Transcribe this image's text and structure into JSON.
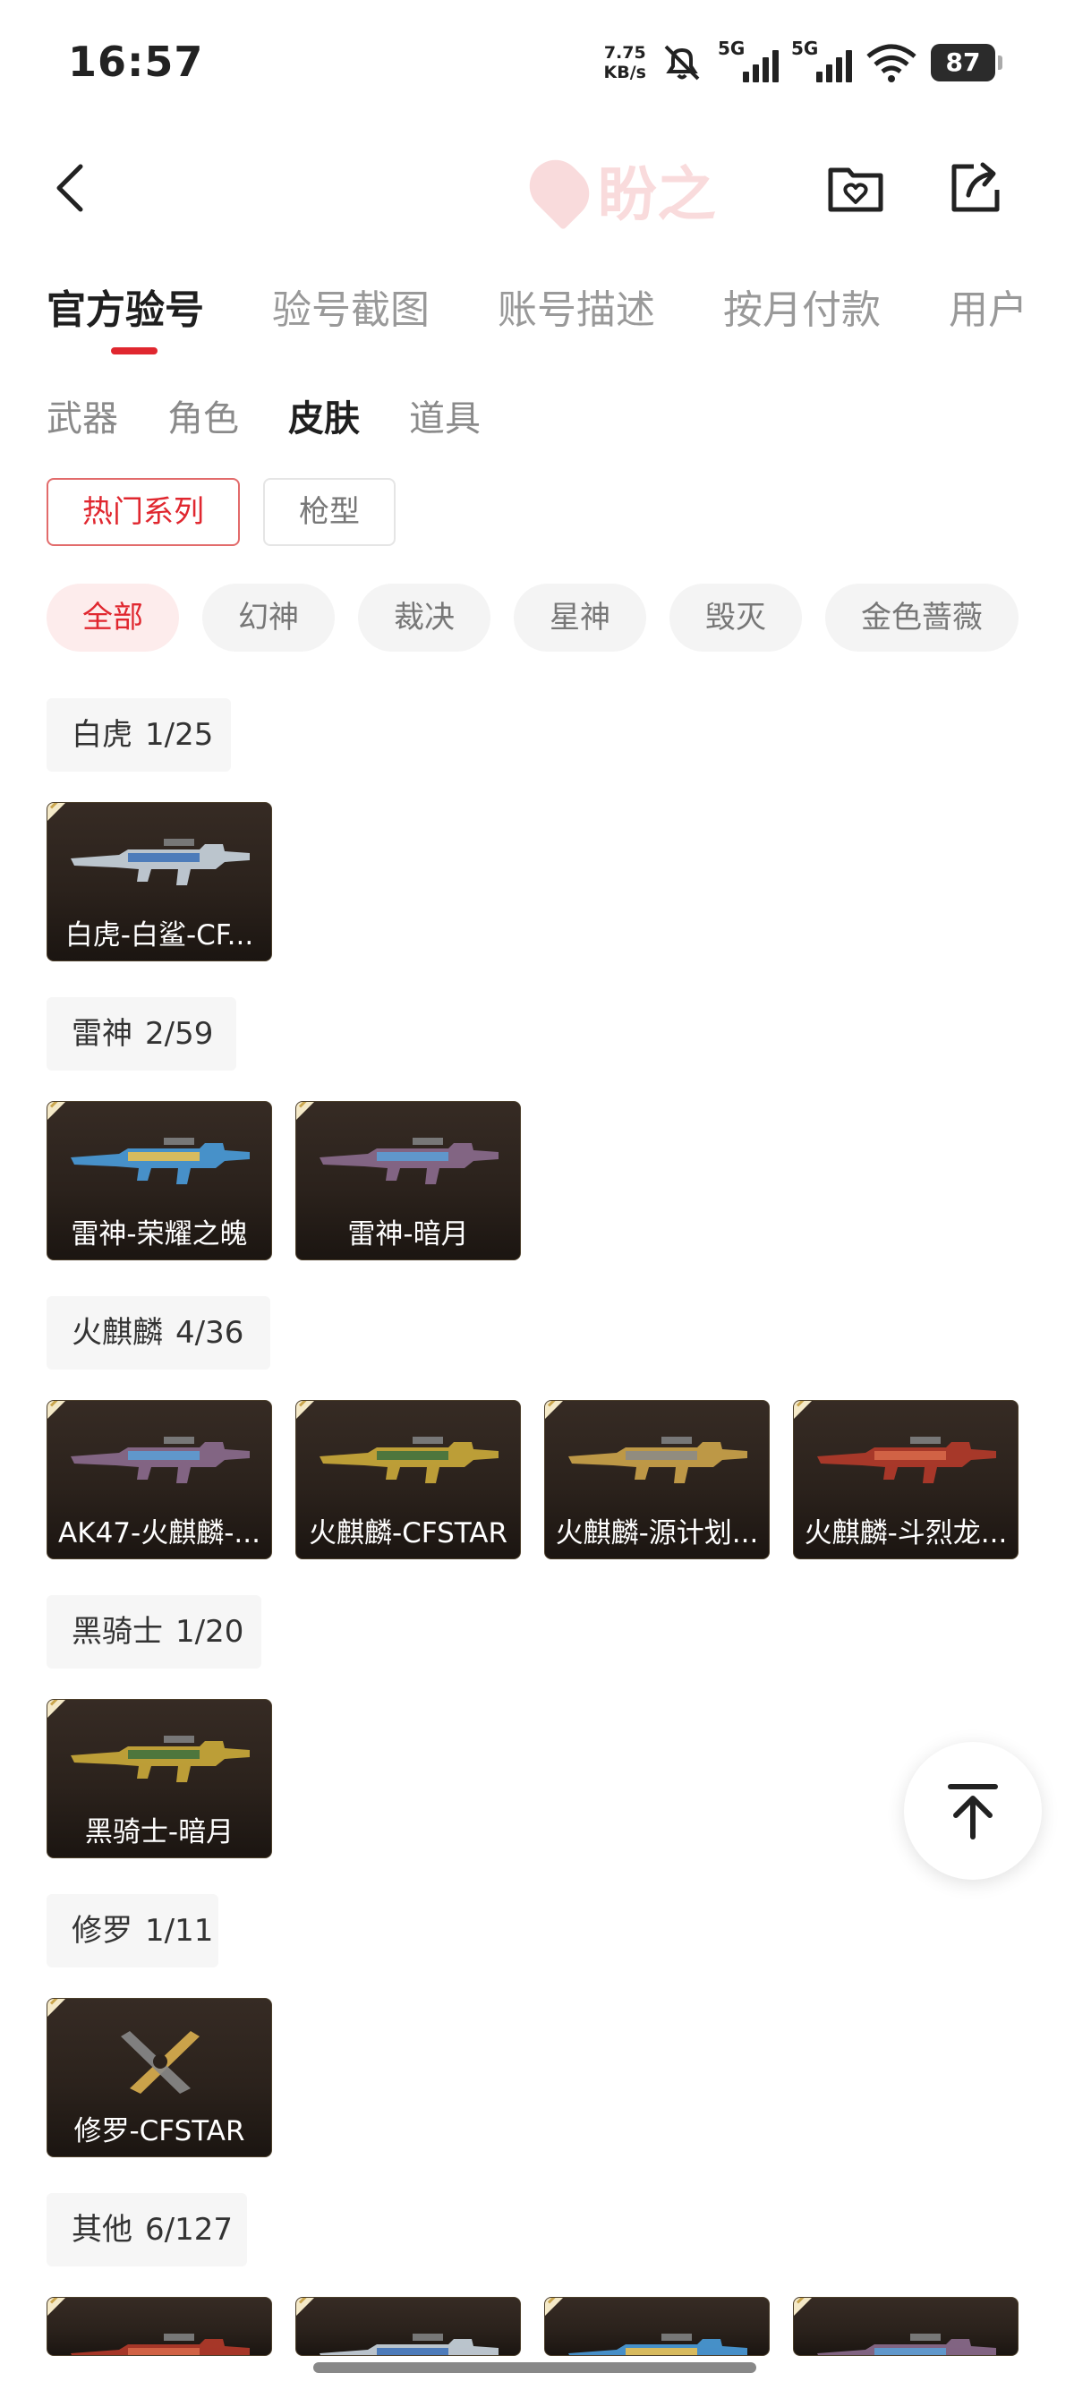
{
  "status_bar": {
    "time": "16:57",
    "net_speed_value": "7.75",
    "net_speed_unit": "KB/s",
    "signal_1_label": "5G",
    "signal_2_label": "5G",
    "battery": "87"
  },
  "nav": {
    "logo_text": "盼之"
  },
  "tabs": [
    "官方验号",
    "验号截图",
    "账号描述",
    "按月付款",
    "用户"
  ],
  "subtabs": [
    "武器",
    "角色",
    "皮肤",
    "道具"
  ],
  "filters": [
    "热门系列",
    "枪型"
  ],
  "chips": [
    "全部",
    "幻神",
    "裁决",
    "星神",
    "毁灭",
    "金色蔷薇"
  ],
  "sections": [
    {
      "title": "白虎",
      "count": "1/25",
      "items": [
        "白虎-白鲨-CF..."
      ]
    },
    {
      "title": "雷神",
      "count": "2/59",
      "items": [
        "雷神-荣耀之魄",
        "雷神-暗月"
      ]
    },
    {
      "title": "火麒麟",
      "count": "4/36",
      "items": [
        "AK47-火麒麟-...",
        "火麒麟-CFSTAR",
        "火麒麟-源计划...",
        "火麒麟-斗烈龙..."
      ]
    },
    {
      "title": "黑骑士",
      "count": "1/20",
      "items": [
        "黑骑士-暗月"
      ]
    },
    {
      "title": "修罗",
      "count": "1/11",
      "items": [
        "修罗-CFSTAR"
      ]
    },
    {
      "title": "其他",
      "count": "6/127",
      "items": [
        "",
        "",
        "",
        ""
      ]
    }
  ],
  "colors": {
    "accent": "#e0272f",
    "card_bg": "#2b221c"
  }
}
